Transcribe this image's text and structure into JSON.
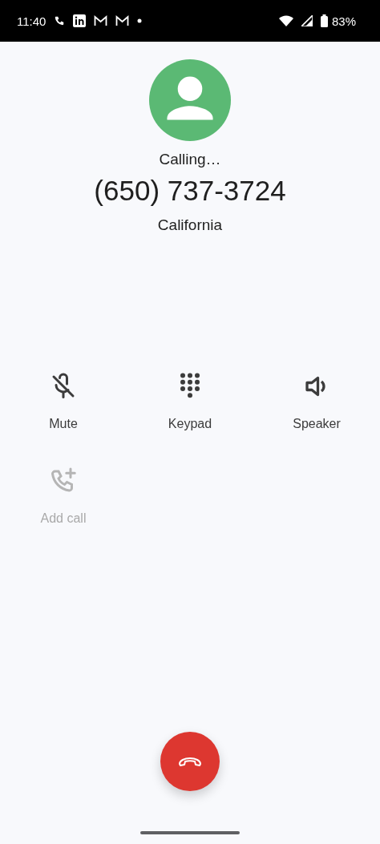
{
  "status_bar": {
    "time": "11:40",
    "battery": "83%"
  },
  "call": {
    "status": "Calling…",
    "number": "(650) 737-3724",
    "location": "California"
  },
  "controls": [
    {
      "kind": "mute",
      "label": "Mute",
      "disabled": false
    },
    {
      "kind": "keypad",
      "label": "Keypad",
      "disabled": false
    },
    {
      "kind": "speaker",
      "label": "Speaker",
      "disabled": false
    },
    {
      "kind": "add_call",
      "label": "Add call",
      "disabled": true
    }
  ]
}
